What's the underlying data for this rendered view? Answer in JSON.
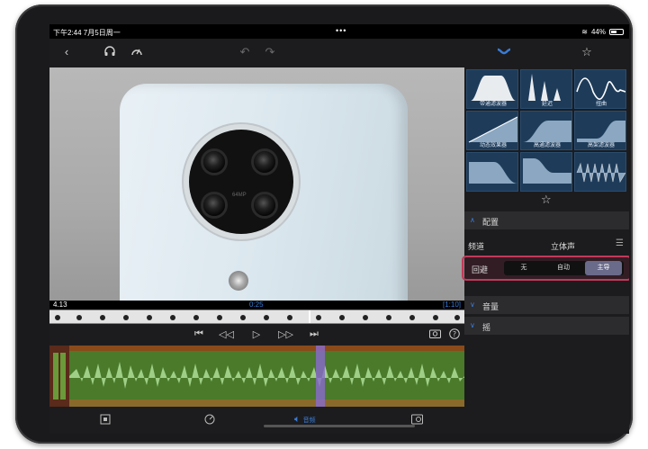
{
  "status": {
    "time_date": "下午2:44  7月5日周一",
    "dots": "•••",
    "battery": "44%"
  },
  "toolbar": {
    "back_icon": "chevron-left-icon",
    "headphones_icon": "headphones-icon",
    "gauge_icon": "gauge-icon",
    "undo_icon": "undo-icon",
    "redo_icon": "redo-icon",
    "audio_settings_icon": "audio-settings-icon",
    "favorite_icon": "star-icon"
  },
  "viewer": {
    "camera_label": "64MP"
  },
  "timeline": {
    "position": "4.13",
    "center": "0:25",
    "end": "[1:10]"
  },
  "transport": {
    "skip_start": "⏮",
    "step_back": "◁◁",
    "play": "▷",
    "step_forward": "▷▷",
    "skip_end": "⏭"
  },
  "bottombar": {
    "audio_label": "音频"
  },
  "filters": [
    {
      "label": "带通滤波器"
    },
    {
      "label": "延迟"
    },
    {
      "label": "扭曲"
    },
    {
      "label": "动态效果器"
    },
    {
      "label": "高通滤波器"
    },
    {
      "label": "高架滤波器"
    },
    {
      "label": ""
    },
    {
      "label": ""
    },
    {
      "label": ""
    }
  ],
  "panel": {
    "config_title": "配置",
    "channel_label": "频道",
    "channel_value": "立体声",
    "duck_label": "回避",
    "duck_options": [
      "无",
      "自动",
      "主导"
    ],
    "duck_selected": "主导",
    "volume_title": "音量",
    "shake_title": "摇"
  },
  "colors": {
    "accent": "#3a7bd5",
    "highlight": "#c23a5a",
    "tile_bg": "#1e3c5a"
  }
}
